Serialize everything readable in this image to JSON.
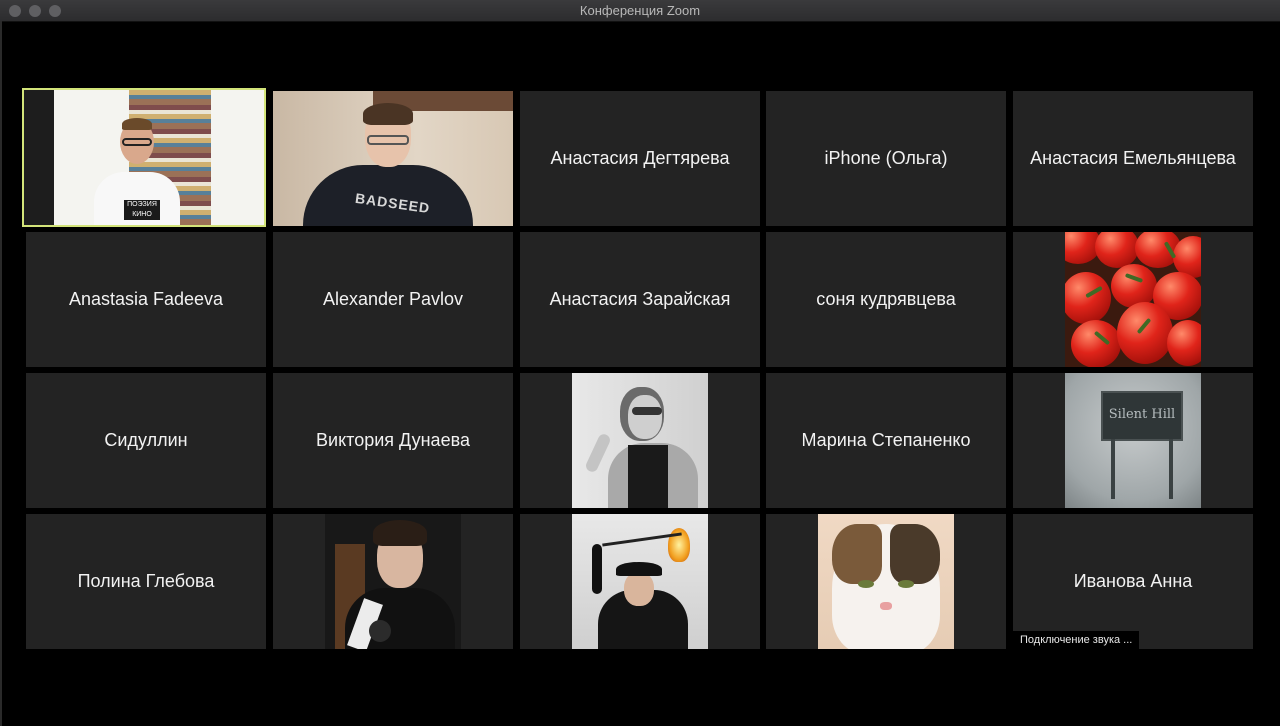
{
  "window": {
    "title": "Конференция Zoom"
  },
  "participants": [
    {
      "name": "",
      "view": "video",
      "active": true
    },
    {
      "name": "",
      "view": "video"
    },
    {
      "name": "Анастасия Дегтярева",
      "view": "name"
    },
    {
      "name": "iPhone (Ольга)",
      "view": "name"
    },
    {
      "name": "Анастасия Емельянцева",
      "view": "name"
    },
    {
      "name": "Anastasia Fadeeva",
      "view": "name"
    },
    {
      "name": "Alexander Pavlov",
      "view": "name"
    },
    {
      "name": "Анастасия Зарайская",
      "view": "name"
    },
    {
      "name": "соня кудрявцева",
      "view": "name"
    },
    {
      "name": "",
      "view": "photo",
      "photo": "tomatoes"
    },
    {
      "name": "Сидуллин",
      "view": "name"
    },
    {
      "name": "Виктория Дунаева",
      "view": "name"
    },
    {
      "name": "",
      "view": "photo",
      "photo": "woman-portrait-bw"
    },
    {
      "name": "Марина Степаненко",
      "view": "name"
    },
    {
      "name": "",
      "view": "photo",
      "photo": "silent-hill-sign"
    },
    {
      "name": "Полина Глебова",
      "view": "name"
    },
    {
      "name": "",
      "view": "photo",
      "photo": "man-portrait"
    },
    {
      "name": "",
      "view": "photo",
      "photo": "woman-with-torch"
    },
    {
      "name": "",
      "view": "photo",
      "photo": "cat"
    },
    {
      "name": "Иванова Анна",
      "view": "name"
    }
  ],
  "video_overlays": {
    "shirt_print": "ПОЭЗИЯ КИНО",
    "hoodie_print": "BADSEED",
    "sign_text": "Silent Hill"
  },
  "status": {
    "text": "Подключение звука ...",
    "visible": true
  },
  "colors": {
    "tile_bg": "#232323",
    "active_border": "#d3e47a",
    "background": "#000000"
  }
}
